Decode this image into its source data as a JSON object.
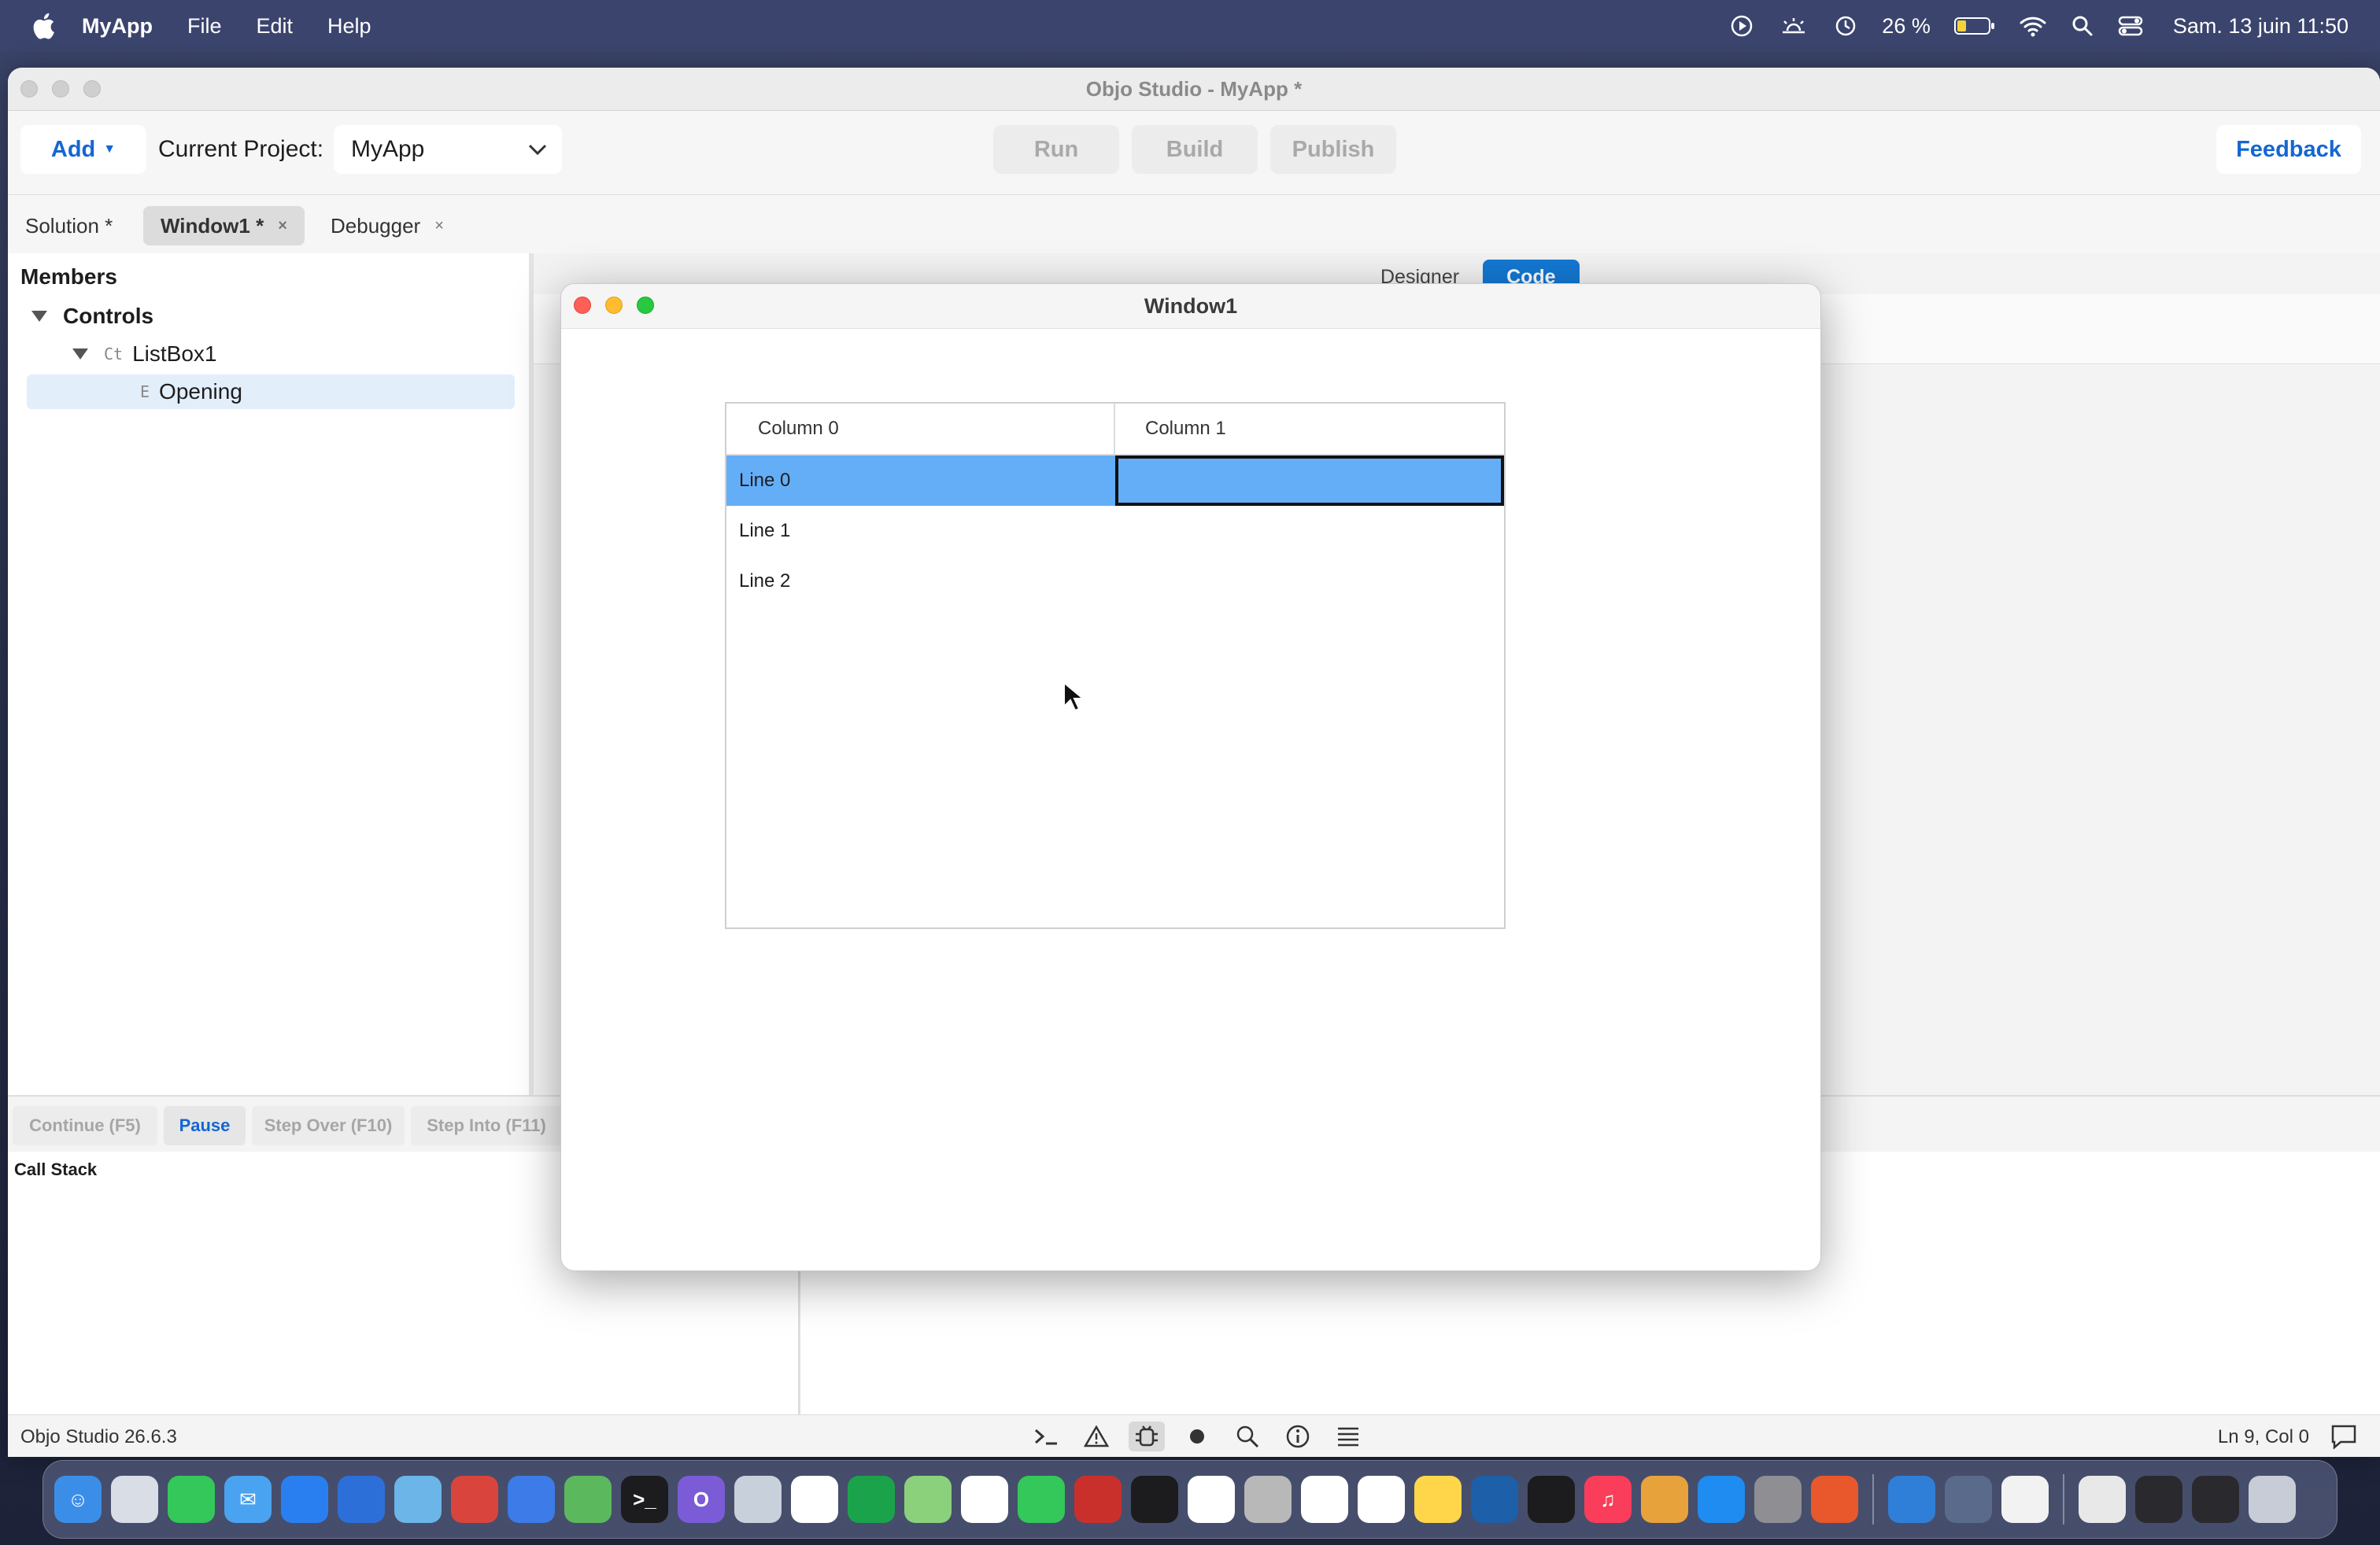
{
  "menubar": {
    "app_name": "MyApp",
    "menus": [
      "File",
      "Edit",
      "Help"
    ],
    "battery": "26 %",
    "clock": "Sam. 13 juin  11:50"
  },
  "main_window": {
    "title": "Objo Studio - MyApp *",
    "toolbar": {
      "add_label": "Add",
      "project_label": "Current Project:",
      "project_value": "MyApp",
      "run_label": "Run",
      "build_label": "Build",
      "publish_label": "Publish",
      "feedback_label": "Feedback"
    },
    "tabs": [
      {
        "label": "Solution *",
        "closable": false
      },
      {
        "label": "Window1 *",
        "closable": true,
        "active": true
      },
      {
        "label": "Debugger",
        "closable": true
      }
    ],
    "tab_close_glyph": "×",
    "members": {
      "title": "Members",
      "controls_label": "Controls",
      "listbox_kind": "Ct",
      "listbox_label": "ListBox1",
      "event_kind": "E",
      "event_label": "Opening"
    },
    "editor": {
      "designer_label": "Designer",
      "code_label": "Code"
    },
    "debug": {
      "continue_label": "Continue (F5)",
      "pause_label": "Pause",
      "step_over_label": "Step Over (F10)",
      "step_into_label": "Step Into (F11)",
      "callstack_label": "Call Stack"
    },
    "status": {
      "version": "Objo Studio 26.6.3",
      "position": "Ln 9, Col 0",
      "icons": [
        "terminal-icon",
        "warning-icon",
        "debug-icon",
        "record-icon",
        "search-icon",
        "info-icon",
        "list-icon"
      ]
    }
  },
  "window1": {
    "title": "Window1",
    "listbox": {
      "columns": [
        "Column 0",
        "Column 1"
      ],
      "rows": [
        "Line 0",
        "Line 1",
        "Line 2"
      ],
      "selected_row": 0
    }
  },
  "colors": {
    "accent": "#1466d2",
    "selection": "#64aef8",
    "code_tab": "#1478d4"
  }
}
